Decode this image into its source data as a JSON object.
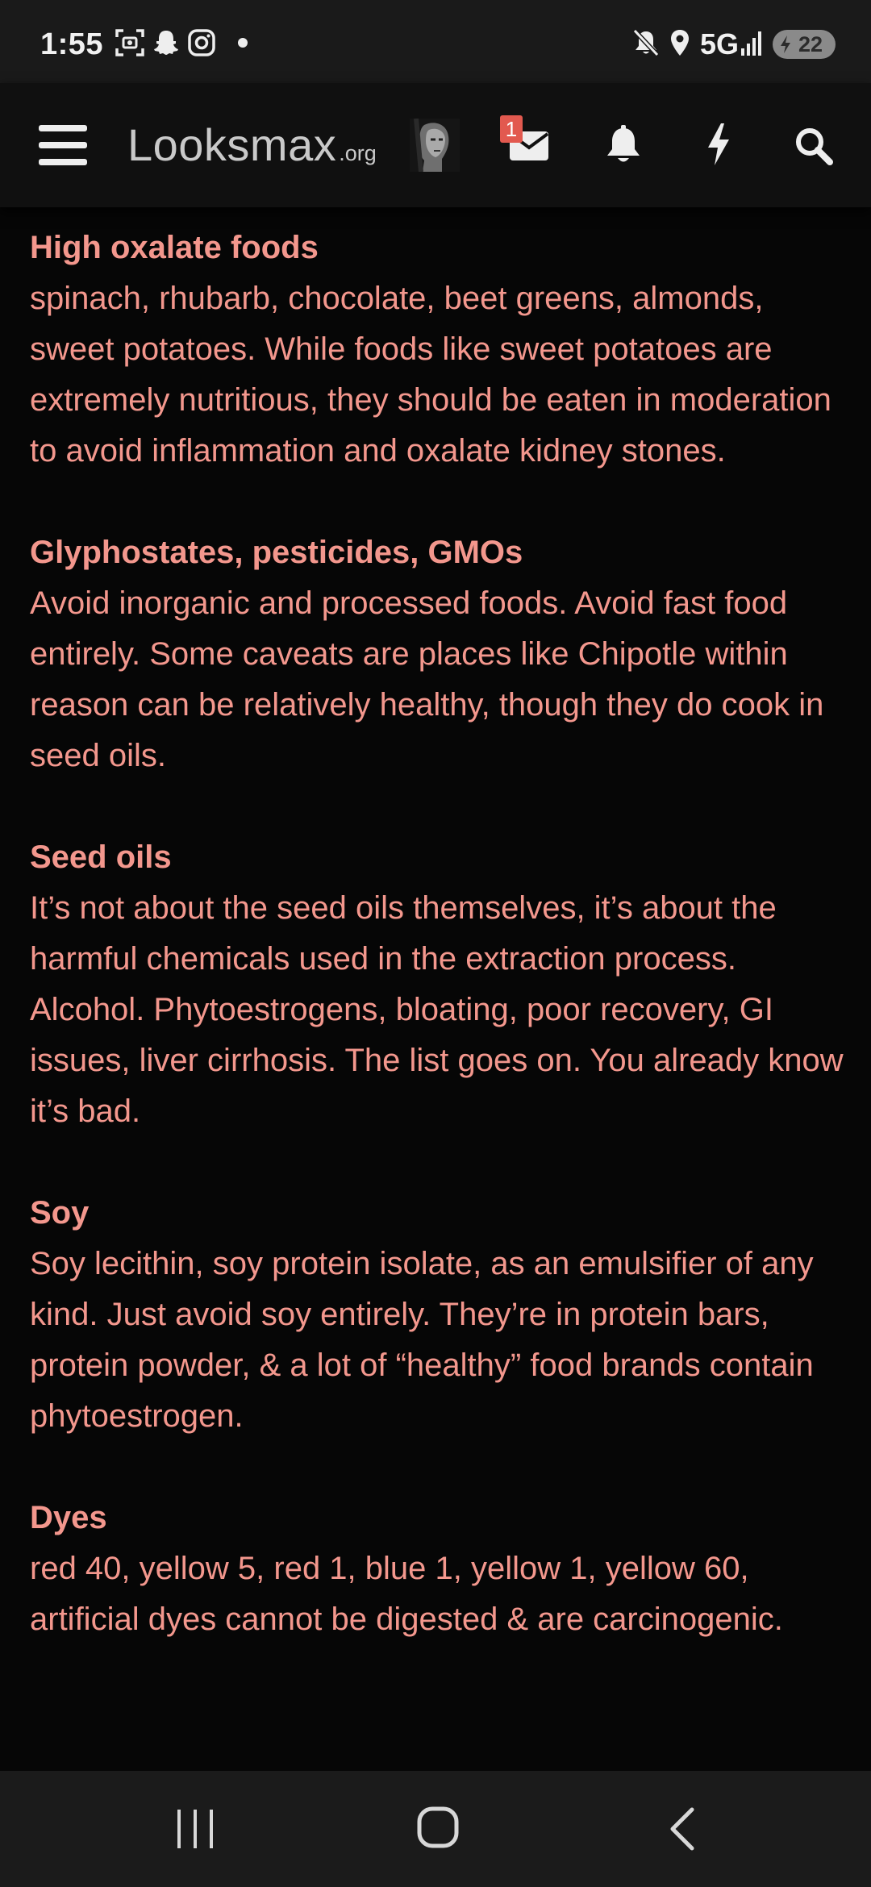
{
  "status_bar": {
    "time": "1:55",
    "network": "5G",
    "battery": "22",
    "left_icons": [
      "screenshot-icon",
      "snapchat-icon",
      "instagram-icon",
      "dot-icon"
    ],
    "right_icons": [
      "mute-icon",
      "location-icon",
      "signal-icon",
      "battery-charging-icon"
    ]
  },
  "header": {
    "logo_main": "Looksmax",
    "logo_suffix": ".org",
    "inbox_badge": "1",
    "icons": [
      "menu-icon",
      "avatar",
      "inbox-icon",
      "bell-icon",
      "bolt-icon",
      "search-icon"
    ]
  },
  "article": {
    "sections": [
      {
        "title": "High oxalate foods",
        "paragraphs": [
          "spinach, rhubarb, chocolate, beet greens, almonds, sweet potatoes. While foods like sweet potatoes are extremely nutritious, they should be eaten in moderation to avoid inflammation and oxalate kidney stones."
        ]
      },
      {
        "title": "Glyphostates, pesticides, GMOs",
        "paragraphs": [
          "Avoid inorganic and processed foods. Avoid fast food entirely. Some caveats are places like Chipotle within reason can be relatively healthy, though they do cook in seed oils."
        ]
      },
      {
        "title": "Seed oils",
        "paragraphs": [
          "It’s not about the seed oils themselves, it’s about the harmful chemicals used in the extraction process.",
          "Alcohol. Phytoestrogens, bloating, poor recovery, GI issues, liver cirrhosis. The list goes on. You already know it’s bad."
        ]
      },
      {
        "title": "Soy",
        "paragraphs": [
          "Soy lecithin, soy protein isolate, as an emulsifier of any kind. Just avoid soy entirely. They’re in protein bars, protein powder, & a lot of “healthy” food brands contain phytoestrogen."
        ]
      },
      {
        "title": "Dyes",
        "paragraphs": [
          "red 40, yellow 5, red 1, blue 1, yellow 1, yellow 60, artificial dyes cannot be digested & are carcinogenic."
        ]
      }
    ]
  },
  "nav_bar": {
    "buttons": [
      "recent-apps-button",
      "home-button",
      "back-button"
    ]
  },
  "colors": {
    "text_accent": "#f3978d",
    "background": "#060606",
    "header_bg": "#101010",
    "badge": "#e2594f"
  }
}
